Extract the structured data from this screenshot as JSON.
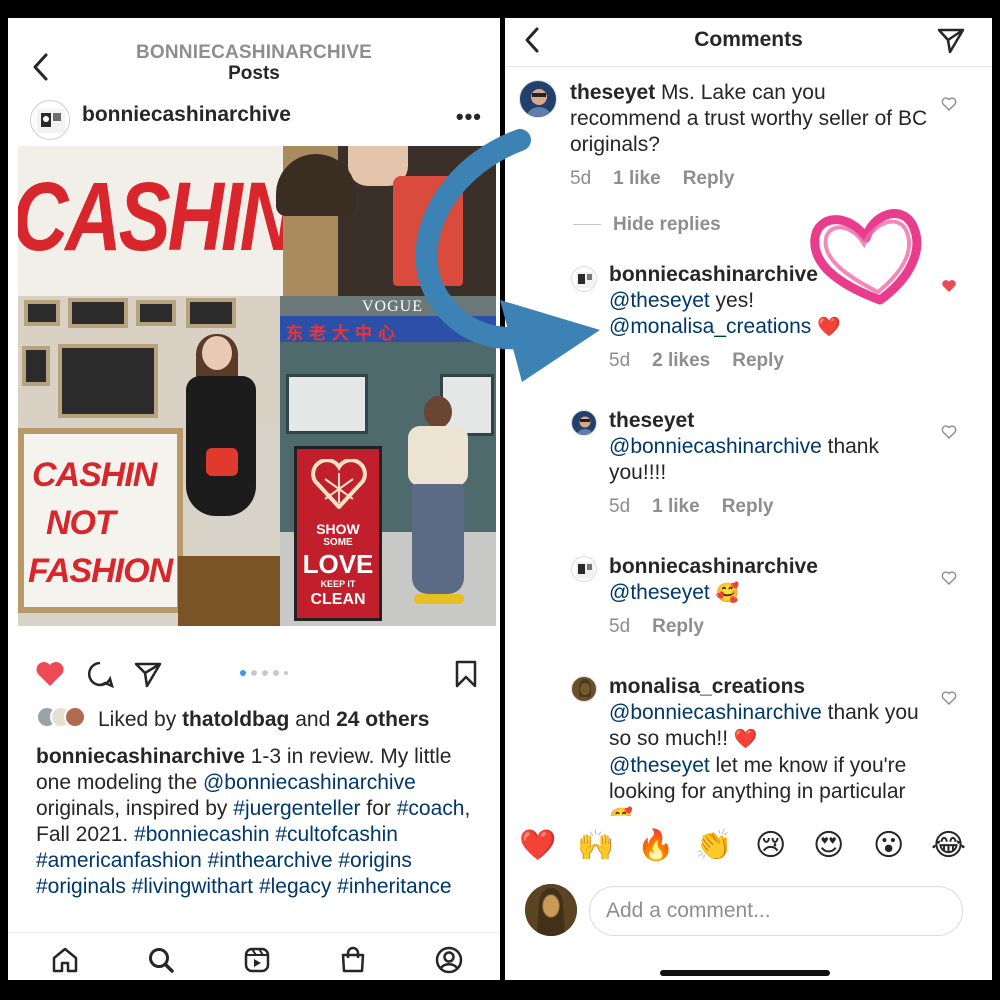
{
  "left": {
    "header": {
      "account": "BONNIECASHINARCHIVE",
      "section": "Posts"
    },
    "post": {
      "username": "bonniecashinarchive",
      "more": "•••",
      "image_texts": {
        "sign_top": "CASHIN",
        "sign_bottom": [
          "CASHIN",
          "NOT",
          "FASHION"
        ],
        "vogue": "VOGUE",
        "banner": "东老大中心",
        "box": [
          "SHOW",
          "SOME",
          "LOVE",
          "KEEP IT",
          "CLEAN"
        ]
      },
      "carousel": {
        "count": 5,
        "active": 0
      },
      "liked_prefix": "Liked by ",
      "liked_user": "thatoldbag",
      "liked_mid": " and ",
      "liked_count": "24 others",
      "caption": {
        "user": "bonniecashinarchive",
        "t1": " 1-3 in review.  My little one modeling the ",
        "mention": "@bonniecashinarchive",
        "t2": " originals, inspired by ",
        "tag1": "#juergenteller",
        "t3": " for ",
        "tag2": "#coach",
        "t4": ", Fall 2021. ",
        "tags": "#bonniecashin #cultofcashin #americanfashion #inthearchive #origins #originals #livingwithart #legacy #inheritance"
      }
    },
    "nav": [
      "home-icon",
      "search-icon",
      "reels-icon",
      "shop-icon",
      "profile-icon"
    ]
  },
  "right": {
    "title": "Comments",
    "comments": [
      {
        "user": "theseyet",
        "text": " Ms. Lake can you recommend a trust worthy seller of BC originals?",
        "age": "5d",
        "likes": "1 like",
        "reply": "Reply"
      }
    ],
    "hide_replies": "Hide replies",
    "replies": [
      {
        "user": "bonniecashinarchive",
        "mention1": "@theseyet",
        "t1": " yes!",
        "mention2": "@monalisa_creations",
        "emoji": "❤️",
        "age": "5d",
        "likes": "2 likes",
        "reply": "Reply",
        "liked": true
      },
      {
        "user": "theseyet",
        "mention1": "@bonniecashinarchive",
        "t1": " thank you!!!!",
        "age": "5d",
        "likes": "1 like",
        "reply": "Reply"
      },
      {
        "user": "bonniecashinarchive",
        "mention1": "@theseyet",
        "emoji": "🥰",
        "age": "5d",
        "reply": "Reply"
      },
      {
        "user": "monalisa_creations",
        "mention1": "@bonniecashinarchive",
        "t1": " thank you so so much!! ",
        "emoji": "❤️",
        "mention2": "@theseyet",
        "t2": " let me know if you're looking for anything in particular ",
        "emoji2": "🥰"
      }
    ],
    "emoji_bar": [
      "❤️",
      "🙌",
      "🔥",
      "👏",
      "😢",
      "😍",
      "😮",
      "😂"
    ],
    "add_comment_placeholder": "Add a comment..."
  },
  "colors": {
    "like_red": "#ed4956",
    "link_blue": "#00376b",
    "meta_grey": "#8e8e8e",
    "arrow_blue": "#3d82b4",
    "doodle_pink": "#ea3c8c"
  }
}
